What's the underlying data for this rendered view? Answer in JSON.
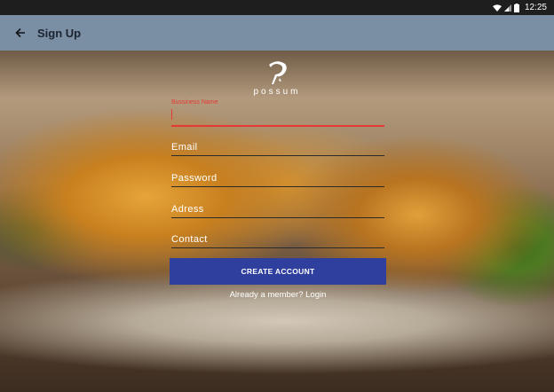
{
  "status_bar": {
    "time": "12:25"
  },
  "toolbar": {
    "title": "Sign Up"
  },
  "logo": {
    "word": "possum"
  },
  "form": {
    "business_name_label": "Bussiness Name",
    "email_placeholder": "Email",
    "password_placeholder": "Password",
    "address_placeholder": "Adress",
    "contact_placeholder": "Contact",
    "create_label": "CREATE ACCOUNT",
    "login_text": "Already a member? Login"
  },
  "colors": {
    "accent_error": "#e53935",
    "button": "#2f3f9e",
    "toolbar": "#7a8ea4"
  }
}
